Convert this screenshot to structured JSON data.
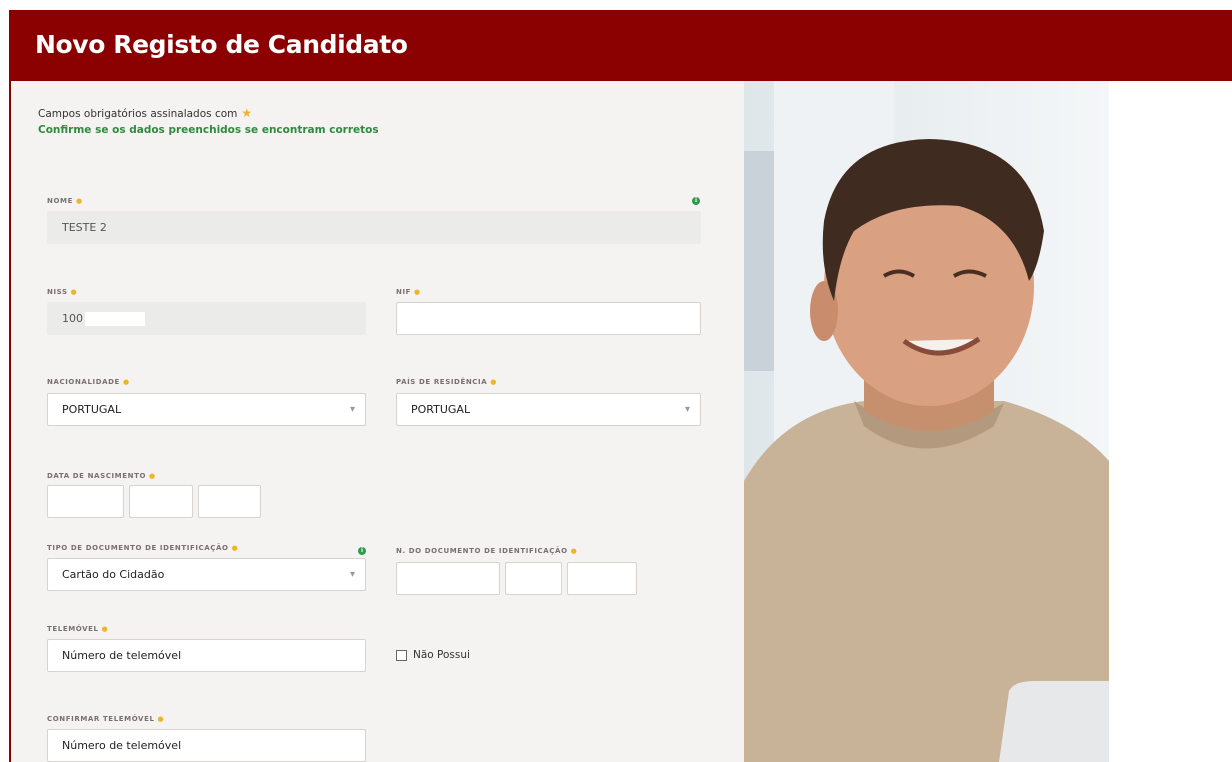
{
  "header": {
    "title": "Novo Registo de Candidato"
  },
  "intro": {
    "required_note": "Campos obrigatórios assinalados com",
    "confirm_note": "Confirme se os dados preenchidos se encontram corretos"
  },
  "fields": {
    "nome": {
      "label": "NOME",
      "value": "TESTE 2"
    },
    "niss": {
      "label": "NISS",
      "value": "100"
    },
    "nif": {
      "label": "NIF",
      "value": ""
    },
    "nacionalidade": {
      "label": "NACIONALIDADE",
      "value": "PORTUGAL"
    },
    "pais_residencia": {
      "label": "PAÍS DE RESIDÊNCIA",
      "value": "PORTUGAL"
    },
    "data_nascimento": {
      "label": "DATA DE NASCIMENTO"
    },
    "tipo_documento": {
      "label": "TIPO DE DOCUMENTO DE IDENTIFICAÇÃO",
      "value": "Cartão do Cidadão"
    },
    "n_documento": {
      "label": "N. DO DOCUMENTO DE IDENTIFICAÇÃO"
    },
    "telemovel": {
      "label": "TELEMÓVEL",
      "placeholder": "Número de telemóvel",
      "no_phone_label": "Não Possui"
    },
    "confirmar_telemovel": {
      "label": "CONFIRMAR TELEMÓVEL",
      "placeholder": "Número de telemóvel"
    }
  },
  "colors": {
    "header_bg": "#8b0000",
    "required_star": "#f0b429",
    "confirm_text": "#2e8b3e",
    "info_icon": "#2e9b4e"
  },
  "icons": {
    "required": "star-icon",
    "info": "info-icon",
    "dropdown": "chevron-down-icon"
  }
}
